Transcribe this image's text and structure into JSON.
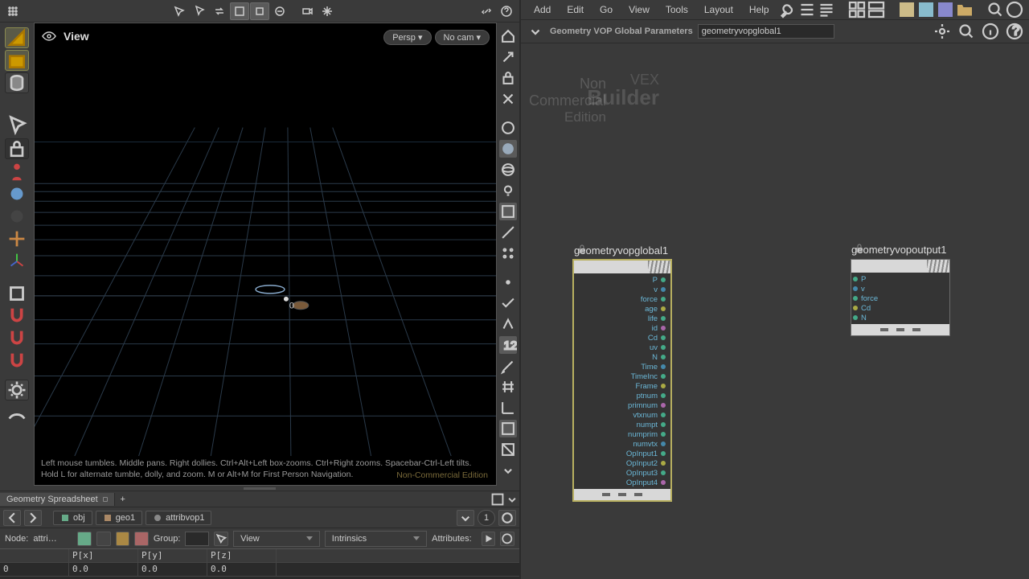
{
  "viewport": {
    "title": "View",
    "persp_label": "Persp",
    "cam_label": "No cam",
    "hint": "Left mouse tumbles. Middle pans. Right dollies. Ctrl+Alt+Left box-zooms. Ctrl+Right zooms. Spacebar-Ctrl-Left tilts. Hold L for alternate tumble, dolly, and zoom. M or Alt+M for First Person Navigation.",
    "edition_wm": "Non-Commercial Edition"
  },
  "spreadsheet": {
    "tab_label": "Geometry Spreadsheet",
    "breadcrumbs": [
      "obj",
      "geo1",
      "attribvop1"
    ],
    "node_label": "Node:",
    "node_value": "attri…",
    "group_label": "Group:",
    "view_dd": "View",
    "intrinsics_dd": "Intrinsics",
    "attrs_label": "Attributes:",
    "pin_value": "1",
    "headers": [
      "",
      "P[x]",
      "P[y]",
      "P[z]"
    ],
    "row": [
      "0",
      "0.0",
      "0.0",
      "0.0"
    ]
  },
  "menu": {
    "items": [
      "Add",
      "Edit",
      "Go",
      "View",
      "Tools",
      "Layout",
      "Help"
    ]
  },
  "param": {
    "type_label": "Geometry VOP Global Parameters",
    "name_value": "geometryvopglobal1"
  },
  "graph": {
    "wm": {
      "l1": "Non",
      "l2": "VEX",
      "l3": "Commercial",
      "l4": "Builder",
      "l5": "Edition"
    },
    "node1": {
      "title": "geometryvopglobal1",
      "outs": [
        "P",
        "v",
        "force",
        "age",
        "life",
        "id",
        "Cd",
        "uv",
        "N",
        "Time",
        "TimeInc",
        "Frame",
        "ptnum",
        "primnum",
        "vtxnum",
        "numpt",
        "numprim",
        "numvtx",
        "OpInput1",
        "OpInput2",
        "OpInput3",
        "OpInput4"
      ]
    },
    "node2": {
      "title": "geometryvopoutput1",
      "ins": [
        "P",
        "v",
        "force",
        "Cd",
        "N"
      ]
    }
  }
}
